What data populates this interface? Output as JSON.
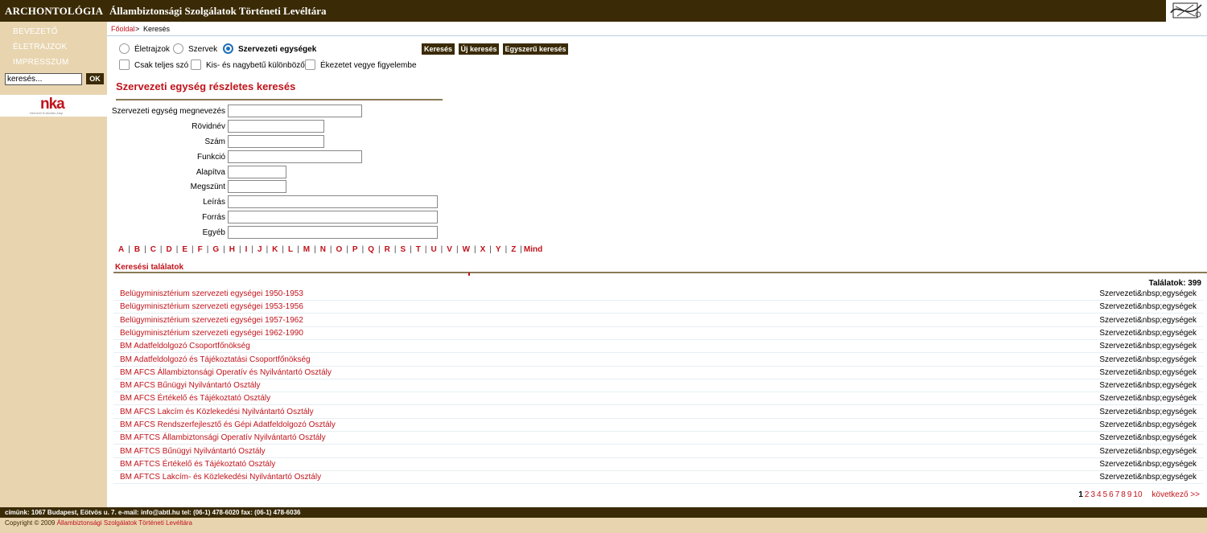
{
  "header": {
    "site_title": "ARCHONTOLÓGIA",
    "archive_title": "Állambiztonsági Szolgálatok Történeti Levéltára",
    "logo_icon": "archive-logo-icon"
  },
  "sidebar": {
    "items": [
      {
        "label": "BEVEZETŐ"
      },
      {
        "label": "ÉLETRAJZOK"
      },
      {
        "label": "IMPRESSZUM"
      }
    ],
    "search_value": "keresés...",
    "ok_label": "OK",
    "sponsor_logo": "nka",
    "sponsor_sub": "Nemzeti Kulturális Alap"
  },
  "breadcrumb": {
    "home": "Főoldal",
    "separator": ">",
    "current": "Keresés"
  },
  "search_options": {
    "radios": [
      {
        "label": "Életrajzok",
        "selected": false
      },
      {
        "label": "Szervek",
        "selected": false
      },
      {
        "label": "Szervezeti egységek",
        "selected": true
      }
    ],
    "checkboxes": [
      {
        "label": "Csak teljes szó",
        "checked": false
      },
      {
        "label": "Kis- és nagybetű különböző",
        "checked": false
      },
      {
        "label": "Ékezetet vegye figyelembe",
        "checked": false
      }
    ],
    "buttons": {
      "search": "Keresés",
      "new_search": "Új keresés",
      "simple_search": "Egyszerű keresés"
    }
  },
  "form": {
    "title": "Szervezeti egység részletes keresés",
    "fields": [
      {
        "label": "Szervezeti egység megnevezés",
        "value": ""
      },
      {
        "label": "Rövidnév",
        "value": ""
      },
      {
        "label": "Szám",
        "value": ""
      },
      {
        "label": "Funkció",
        "value": ""
      },
      {
        "label": "Alapítva",
        "value": ""
      },
      {
        "label": "Megszünt",
        "value": ""
      },
      {
        "label": "Leírás",
        "value": ""
      },
      {
        "label": "Forrás",
        "value": ""
      },
      {
        "label": "Egyéb",
        "value": ""
      }
    ]
  },
  "alphabet": [
    "A",
    "B",
    "C",
    "D",
    "E",
    "F",
    "G",
    "H",
    "I",
    "J",
    "K",
    "L",
    "M",
    "N",
    "O",
    "P",
    "Q",
    "R",
    "S",
    "T",
    "U",
    "V",
    "W",
    "X",
    "Y",
    "Z",
    "Mind"
  ],
  "results": {
    "title": "Keresési találatok",
    "count_label": "Találatok: 399",
    "rows": [
      {
        "name": "Belügyminisztérium szervezeti egységei 1950-1953",
        "type": "Szervezeti&nbsp;egységek"
      },
      {
        "name": "Belügyminisztérium szervezeti egységei 1953-1956",
        "type": "Szervezeti&nbsp;egységek"
      },
      {
        "name": "Belügyminisztérium szervezeti egységei 1957-1962",
        "type": "Szervezeti&nbsp;egységek"
      },
      {
        "name": "Belügyminisztérium szervezeti egységei 1962-1990",
        "type": "Szervezeti&nbsp;egységek"
      },
      {
        "name": "BM Adatfeldolgozó Csoportfőnökség",
        "type": "Szervezeti&nbsp;egységek"
      },
      {
        "name": "BM Adatfeldolgozó és Tájékoztatási Csoportfőnökség",
        "type": "Szervezeti&nbsp;egységek"
      },
      {
        "name": "BM AFCS Állambiztonsági Operatív és Nyilvántartó Osztály",
        "type": "Szervezeti&nbsp;egységek"
      },
      {
        "name": "BM AFCS Bűnügyi Nyilvántartó Osztály",
        "type": "Szervezeti&nbsp;egységek"
      },
      {
        "name": "BM AFCS Értékelő és Tájékoztató Osztály",
        "type": "Szervezeti&nbsp;egységek"
      },
      {
        "name": "BM AFCS Lakcím és Közlekedési Nyilvántartó Osztály",
        "type": "Szervezeti&nbsp;egységek"
      },
      {
        "name": "BM AFCS Rendszerfejlesztő és Gépi Adatfeldolgozó Osztály",
        "type": "Szervezeti&nbsp;egységek"
      },
      {
        "name": "BM AFTCS Állambiztonsági Operatív Nyilvántartó Osztály",
        "type": "Szervezeti&nbsp;egységek"
      },
      {
        "name": "BM AFTCS Bűnügyi Nyilvántartó Osztály",
        "type": "Szervezeti&nbsp;egységek"
      },
      {
        "name": "BM AFTCS Értékelő és Tájékoztató Osztály",
        "type": "Szervezeti&nbsp;egységek"
      },
      {
        "name": "BM AFTCS Lakcím- és Közlekedési Nyilvántartó Osztály",
        "type": "Szervezeti&nbsp;egységek"
      }
    ]
  },
  "pagination": {
    "current": "1",
    "pages": [
      "2",
      "3",
      "4",
      "5",
      "6",
      "7",
      "8",
      "9",
      "10"
    ],
    "next_label": "következő >>"
  },
  "footer": {
    "address": "címünk: 1067 Budapest, Eötvös u. 7. e-mail: info@abtl.hu tel: (06-1) 478-6020 fax: (06-1) 478-6036",
    "copyright_prefix": "Copyright © 2009",
    "copyright_org": "Állambiztonsági Szolgálatok Történeti Levéltára"
  },
  "colors": {
    "header_bg": "#3a2a05",
    "sidebar_bg": "#e8d5b0",
    "accent_red": "#c0131b",
    "radio_blue": "#1f6fb8"
  }
}
